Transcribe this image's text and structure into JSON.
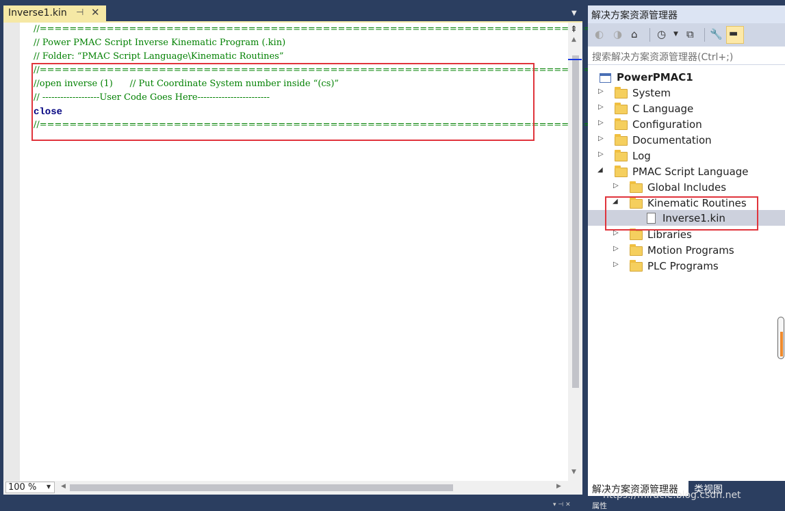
{
  "document_tab": {
    "title": "Inverse1.kin",
    "pin_icon": "pin-icon",
    "close_icon": "close-icon"
  },
  "code_lines": [
    {
      "text": "//==============================================================================",
      "type": "comment"
    },
    {
      "text": "// Power PMAC Script Inverse Kinematic Program (.kin)",
      "type": "comment"
    },
    {
      "text": "// Folder: “PMAC Script Language\\Kinematic Routines”",
      "type": "comment"
    },
    {
      "text": "//==============================================================================",
      "type": "comment"
    },
    {
      "text": "//open inverse (1)      // Put Coordinate System number inside “(cs)”",
      "type": "comment"
    },
    {
      "text": "// -------------------User Code Goes Here------------------------",
      "type": "comment"
    },
    {
      "text": "close",
      "type": "keyword"
    },
    {
      "text": "//==============================================================================",
      "type": "comment"
    }
  ],
  "editor": {
    "zoom": "100 %",
    "highlight_color": "#e0333b"
  },
  "solution_explorer": {
    "title": "解决方案资源管理器",
    "search_placeholder": "搜索解决方案资源管理器(Ctrl+;)",
    "toolbar_icons": [
      "back-icon",
      "forward-icon",
      "home-icon",
      "history-icon",
      "dropdown-icon",
      "collapse-all-icon",
      "properties-wrench-icon",
      "preview-toggle-icon"
    ],
    "tree": {
      "root": "PowerPMAC1",
      "system": "System",
      "c_language": "C Language",
      "configuration": "Configuration",
      "documentation": "Documentation",
      "log": "Log",
      "pmac_script": "PMAC Script Language",
      "global_includes": "Global Includes",
      "kinematic_routines": "Kinematic Routines",
      "inverse_file": "Inverse1.kin",
      "libraries": "Libraries",
      "motion_programs": "Motion Programs",
      "plc_programs": "PLC Programs"
    },
    "bottom_tabs": {
      "solution": "解决方案资源管理器",
      "class_view": "类视图"
    },
    "bottom_label": "属性"
  },
  "colors": {
    "accent_tab": "#f5e8a5",
    "chrome": "#2b3e60",
    "comment": "#008000",
    "keyword": "#000080"
  },
  "watermark": "https://miracle.blog.csdn.net"
}
